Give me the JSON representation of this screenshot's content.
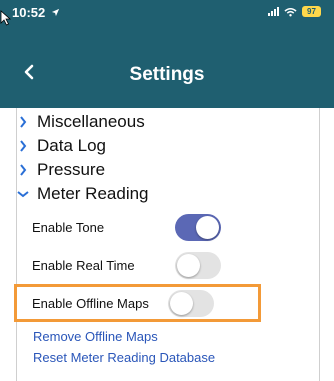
{
  "status_bar": {
    "time": "10:52",
    "battery": "97"
  },
  "header": {
    "title": "Settings",
    "back_icon": "chevron-left-icon"
  },
  "colors": {
    "header_bg": "#1f5f70",
    "toggle_on": "#5b68b5",
    "link": "#2a56b9",
    "highlight": "#f39a38"
  },
  "menu": [
    {
      "label": "Miscellaneous",
      "expanded": false
    },
    {
      "label": "Data Log",
      "expanded": false
    },
    {
      "label": "Pressure",
      "expanded": false
    },
    {
      "label": "Meter Reading",
      "expanded": true
    }
  ],
  "meter_reading": {
    "toggles": [
      {
        "label": "Enable Tone",
        "on": true
      },
      {
        "label": "Enable Real Time",
        "on": false
      },
      {
        "label": "Enable Offline Maps",
        "on": false
      }
    ],
    "links": [
      "Remove Offline Maps",
      "Reset Meter Reading Database"
    ]
  }
}
